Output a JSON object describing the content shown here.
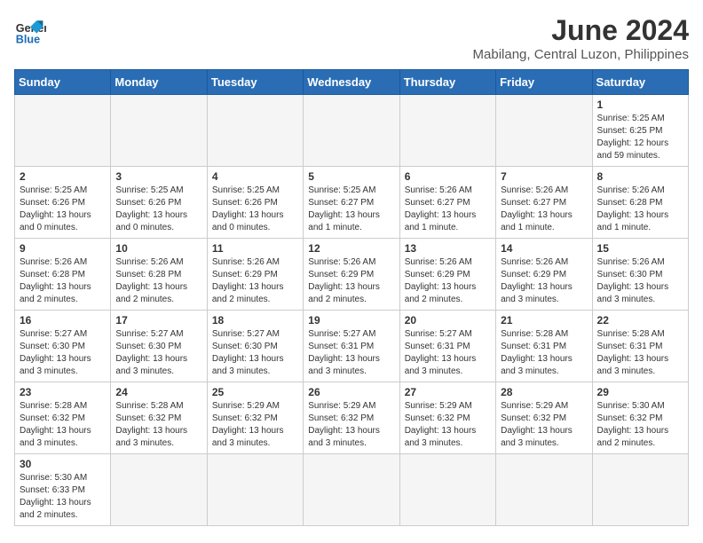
{
  "logo": {
    "line1": "General",
    "line2": "Blue"
  },
  "title": "June 2024",
  "subtitle": "Mabilang, Central Luzon, Philippines",
  "days_of_week": [
    "Sunday",
    "Monday",
    "Tuesday",
    "Wednesday",
    "Thursday",
    "Friday",
    "Saturday"
  ],
  "weeks": [
    [
      {
        "day": "",
        "info": "",
        "empty": true
      },
      {
        "day": "",
        "info": "",
        "empty": true
      },
      {
        "day": "",
        "info": "",
        "empty": true
      },
      {
        "day": "",
        "info": "",
        "empty": true
      },
      {
        "day": "",
        "info": "",
        "empty": true
      },
      {
        "day": "",
        "info": "",
        "empty": true
      },
      {
        "day": "1",
        "info": "Sunrise: 5:25 AM\nSunset: 6:25 PM\nDaylight: 12 hours\nand 59 minutes."
      }
    ],
    [
      {
        "day": "2",
        "info": "Sunrise: 5:25 AM\nSunset: 6:26 PM\nDaylight: 13 hours\nand 0 minutes."
      },
      {
        "day": "3",
        "info": "Sunrise: 5:25 AM\nSunset: 6:26 PM\nDaylight: 13 hours\nand 0 minutes."
      },
      {
        "day": "4",
        "info": "Sunrise: 5:25 AM\nSunset: 6:26 PM\nDaylight: 13 hours\nand 0 minutes."
      },
      {
        "day": "5",
        "info": "Sunrise: 5:25 AM\nSunset: 6:27 PM\nDaylight: 13 hours\nand 1 minute."
      },
      {
        "day": "6",
        "info": "Sunrise: 5:26 AM\nSunset: 6:27 PM\nDaylight: 13 hours\nand 1 minute."
      },
      {
        "day": "7",
        "info": "Sunrise: 5:26 AM\nSunset: 6:27 PM\nDaylight: 13 hours\nand 1 minute."
      },
      {
        "day": "8",
        "info": "Sunrise: 5:26 AM\nSunset: 6:28 PM\nDaylight: 13 hours\nand 1 minute."
      }
    ],
    [
      {
        "day": "9",
        "info": "Sunrise: 5:26 AM\nSunset: 6:28 PM\nDaylight: 13 hours\nand 2 minutes."
      },
      {
        "day": "10",
        "info": "Sunrise: 5:26 AM\nSunset: 6:28 PM\nDaylight: 13 hours\nand 2 minutes."
      },
      {
        "day": "11",
        "info": "Sunrise: 5:26 AM\nSunset: 6:29 PM\nDaylight: 13 hours\nand 2 minutes."
      },
      {
        "day": "12",
        "info": "Sunrise: 5:26 AM\nSunset: 6:29 PM\nDaylight: 13 hours\nand 2 minutes."
      },
      {
        "day": "13",
        "info": "Sunrise: 5:26 AM\nSunset: 6:29 PM\nDaylight: 13 hours\nand 2 minutes."
      },
      {
        "day": "14",
        "info": "Sunrise: 5:26 AM\nSunset: 6:29 PM\nDaylight: 13 hours\nand 3 minutes."
      },
      {
        "day": "15",
        "info": "Sunrise: 5:26 AM\nSunset: 6:30 PM\nDaylight: 13 hours\nand 3 minutes."
      }
    ],
    [
      {
        "day": "16",
        "info": "Sunrise: 5:27 AM\nSunset: 6:30 PM\nDaylight: 13 hours\nand 3 minutes."
      },
      {
        "day": "17",
        "info": "Sunrise: 5:27 AM\nSunset: 6:30 PM\nDaylight: 13 hours\nand 3 minutes."
      },
      {
        "day": "18",
        "info": "Sunrise: 5:27 AM\nSunset: 6:30 PM\nDaylight: 13 hours\nand 3 minutes."
      },
      {
        "day": "19",
        "info": "Sunrise: 5:27 AM\nSunset: 6:31 PM\nDaylight: 13 hours\nand 3 minutes."
      },
      {
        "day": "20",
        "info": "Sunrise: 5:27 AM\nSunset: 6:31 PM\nDaylight: 13 hours\nand 3 minutes."
      },
      {
        "day": "21",
        "info": "Sunrise: 5:28 AM\nSunset: 6:31 PM\nDaylight: 13 hours\nand 3 minutes."
      },
      {
        "day": "22",
        "info": "Sunrise: 5:28 AM\nSunset: 6:31 PM\nDaylight: 13 hours\nand 3 minutes."
      }
    ],
    [
      {
        "day": "23",
        "info": "Sunrise: 5:28 AM\nSunset: 6:32 PM\nDaylight: 13 hours\nand 3 minutes."
      },
      {
        "day": "24",
        "info": "Sunrise: 5:28 AM\nSunset: 6:32 PM\nDaylight: 13 hours\nand 3 minutes."
      },
      {
        "day": "25",
        "info": "Sunrise: 5:29 AM\nSunset: 6:32 PM\nDaylight: 13 hours\nand 3 minutes."
      },
      {
        "day": "26",
        "info": "Sunrise: 5:29 AM\nSunset: 6:32 PM\nDaylight: 13 hours\nand 3 minutes."
      },
      {
        "day": "27",
        "info": "Sunrise: 5:29 AM\nSunset: 6:32 PM\nDaylight: 13 hours\nand 3 minutes."
      },
      {
        "day": "28",
        "info": "Sunrise: 5:29 AM\nSunset: 6:32 PM\nDaylight: 13 hours\nand 3 minutes."
      },
      {
        "day": "29",
        "info": "Sunrise: 5:30 AM\nSunset: 6:32 PM\nDaylight: 13 hours\nand 2 minutes."
      }
    ],
    [
      {
        "day": "30",
        "info": "Sunrise: 5:30 AM\nSunset: 6:33 PM\nDaylight: 13 hours\nand 2 minutes."
      },
      {
        "day": "",
        "info": "",
        "empty": true
      },
      {
        "day": "",
        "info": "",
        "empty": true
      },
      {
        "day": "",
        "info": "",
        "empty": true
      },
      {
        "day": "",
        "info": "",
        "empty": true
      },
      {
        "day": "",
        "info": "",
        "empty": true
      },
      {
        "day": "",
        "info": "",
        "empty": true
      }
    ]
  ]
}
